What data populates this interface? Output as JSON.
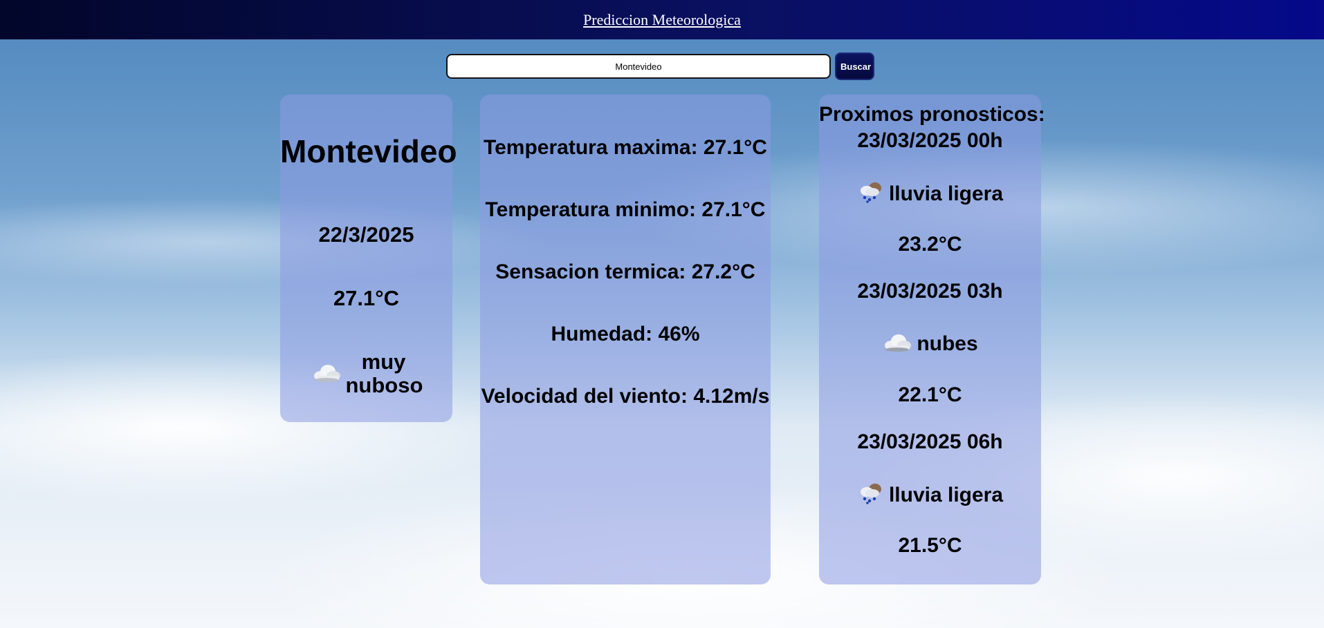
{
  "header": {
    "title": "Prediccion Meteorologica"
  },
  "search": {
    "value": "Montevideo",
    "button_label": "Buscar"
  },
  "current": {
    "city": "Montevideo",
    "date": "22/3/2025",
    "temperature": "27.1°C",
    "condition_icon": "cloud-icon",
    "condition": "muy nuboso"
  },
  "details": {
    "temp_max": "Temperatura maxima: 27.1°C",
    "temp_min": "Temperatura minimo: 27.1°C",
    "feels_like": "Sensacion termica: 27.2°C",
    "humidity": "Humedad: 46%",
    "wind": "Velocidad del viento: 4.12m/s"
  },
  "forecast": {
    "title": "Proximos pronosticos:",
    "items": [
      {
        "datetime": "23/03/2025 00h",
        "icon": "rain-icon",
        "condition": "lluvia ligera",
        "temperature": "23.2°C"
      },
      {
        "datetime": "23/03/2025 03h",
        "icon": "cloud-icon",
        "condition": "nubes",
        "temperature": "22.1°C"
      },
      {
        "datetime": "23/03/2025 06h",
        "icon": "rain-icon",
        "condition": "lluvia ligera",
        "temperature": "21.5°C"
      }
    ]
  }
}
